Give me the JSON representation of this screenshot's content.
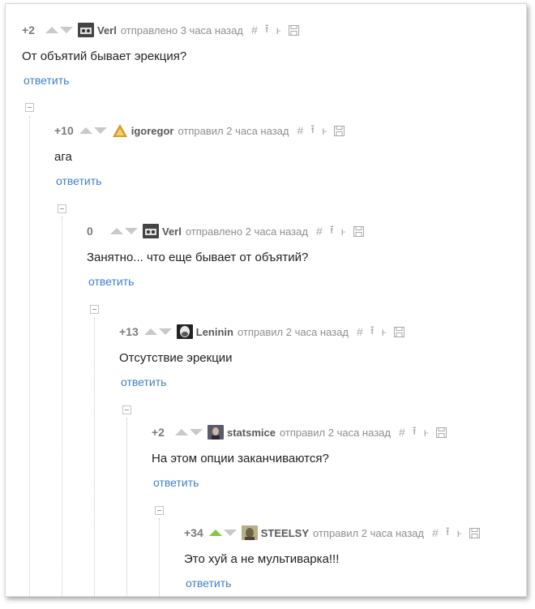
{
  "comments": [
    {
      "rating": "+2",
      "user": "Verl",
      "action": "отправлено 3 часа назад",
      "text": "От объятий бывает эрекция?",
      "reply": "ответить",
      "avatar_color": "#444444",
      "upvoted": false
    },
    {
      "rating": "+10",
      "user": "igoregor",
      "action": "отправил 2 часа назад",
      "text": "ага",
      "reply": "ответить",
      "avatar_color": "#d99a2b",
      "upvoted": false
    },
    {
      "rating": "0",
      "user": "Verl",
      "action": "отправлено 2 часа назад",
      "text": "Занятно... что еще бывает от объятий?",
      "reply": "ответить",
      "avatar_color": "#444444",
      "upvoted": false
    },
    {
      "rating": "+13",
      "user": "Leninin",
      "action": "отправил 2 часа назад",
      "text": "Отсутствие эрекции",
      "reply": "ответить",
      "avatar_color": "#333333",
      "upvoted": false
    },
    {
      "rating": "+2",
      "user": "statsmice",
      "action": "отправил 2 часа назад",
      "text": "На этом опции заканчиваются?",
      "reply": "ответить",
      "avatar_color": "#5a5a6a",
      "upvoted": false
    },
    {
      "rating": "+34",
      "user": "STEELSY",
      "action": "отправил 2 часа назад",
      "text": "Это хуй а не мультиварка!!!",
      "reply": "ответить",
      "avatar_color": "#8a8060",
      "upvoted": true
    }
  ],
  "tool_icons": [
    "hash-icon",
    "up-to-parent-icon",
    "branch-icon",
    "save-icon"
  ],
  "tool_glyphs": {
    "hash": "#",
    "parent": "⭱",
    "branch": "ⱶ"
  },
  "colors": {
    "link": "#3f7fc7",
    "upvote_active": "#8cc63e",
    "muted": "#8e8e8e"
  }
}
